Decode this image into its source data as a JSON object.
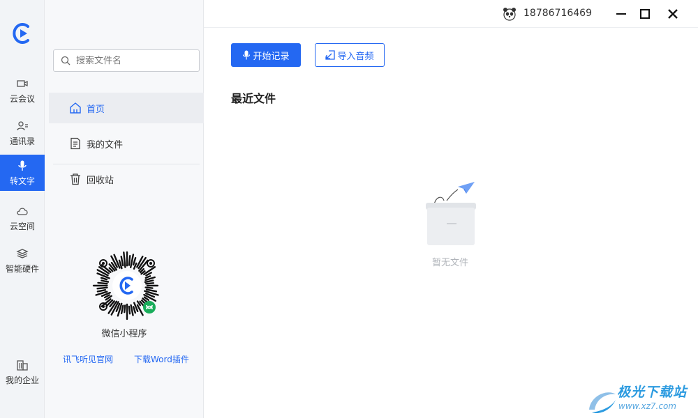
{
  "user": {
    "phone": "18786716469"
  },
  "rail": {
    "items": [
      {
        "label": "云会议",
        "icon": "video-meeting-icon"
      },
      {
        "label": "通讯录",
        "icon": "contacts-icon"
      },
      {
        "label": "转文字",
        "icon": "microphone-icon",
        "active": true
      },
      {
        "label": "云空间",
        "icon": "cloud-icon"
      },
      {
        "label": "智能硬件",
        "icon": "layers-icon"
      }
    ],
    "bottom_item": {
      "label": "我的企业",
      "icon": "building-icon"
    }
  },
  "sidebar": {
    "search_placeholder": "搜索文件名",
    "items": [
      {
        "label": "首页",
        "icon": "home-icon",
        "active": true
      },
      {
        "label": "我的文件",
        "icon": "document-icon"
      },
      {
        "label": "回收站",
        "icon": "trash-icon"
      }
    ],
    "qr_caption": "微信小程序",
    "links": {
      "official_site": "讯飞听见官网",
      "word_plugin": "下载Word插件"
    }
  },
  "main": {
    "start_record_label": "开始记录",
    "import_audio_label": "导入音频",
    "section_title": "最近文件",
    "empty_text": "暂无文件"
  },
  "watermark": {
    "name": "极光下载站",
    "url": "www.xz7.com"
  },
  "colors": {
    "accent": "#2468f2",
    "rail_bg": "#f2f4f7",
    "sidebar_bg": "#f7f8fa"
  }
}
